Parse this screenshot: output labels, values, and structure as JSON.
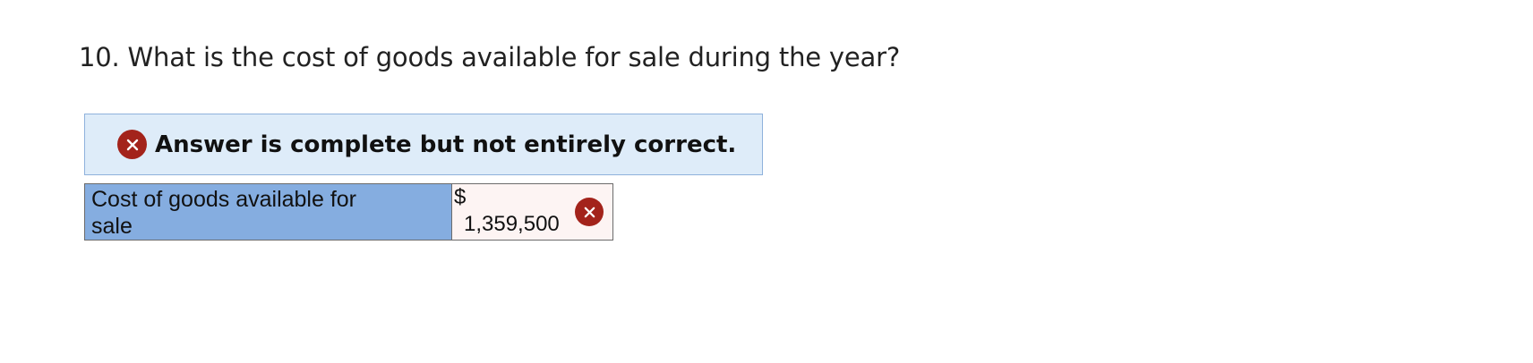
{
  "question": {
    "number": "10.",
    "text": "10. What is the cost of goods available for sale during the year?"
  },
  "feedback": {
    "icon": "x-circle-icon",
    "message": "Answer is complete but not entirely correct.",
    "status_color": "#a3231b",
    "background_color": "#deecf9"
  },
  "answer_table": {
    "rows": [
      {
        "label": "Cost of goods available for sale",
        "currency": "$",
        "value": "1,359,500",
        "status_icon": "x-circle-icon",
        "correct": false
      }
    ],
    "label_background": "#85ade0",
    "value_background": "#fdf4f3"
  }
}
